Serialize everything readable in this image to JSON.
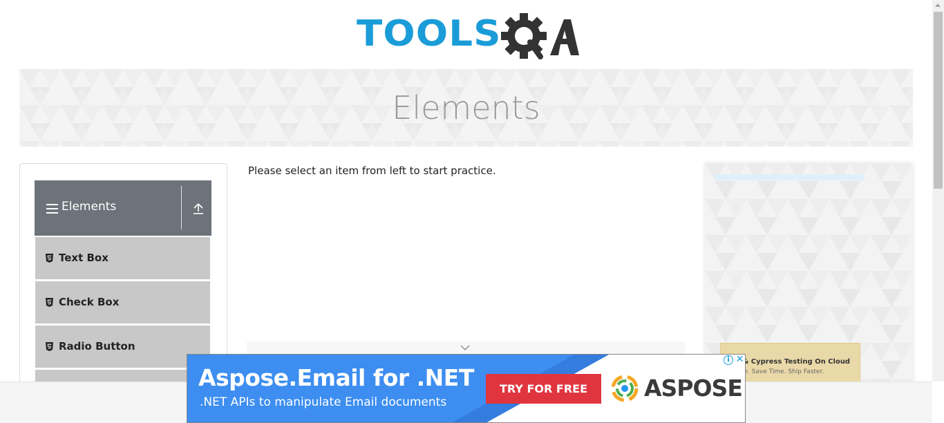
{
  "header": {
    "logo_text_tools": "TOOLS",
    "logo_text_qa": "QA",
    "brand_color": "#1a9cd8"
  },
  "banner": {
    "title": "Elements"
  },
  "sidebar": {
    "group": {
      "title": "Elements",
      "icon": "menu-icon",
      "collapse_icon": "upload-icon",
      "bg_color": "#6c737a"
    },
    "items": [
      {
        "label": "Text Box",
        "icon": "html5-icon"
      },
      {
        "label": "Check Box",
        "icon": "html5-icon"
      },
      {
        "label": "Radio Button",
        "icon": "html5-icon"
      }
    ]
  },
  "main": {
    "instruction": "Please select an item from left to start practice."
  },
  "right_ad": {
    "line1": "nium & Cypress Testing On Cloud",
    "line2": "est More. Save Time. Ship Faster."
  },
  "ad_banner": {
    "title": "Aspose.Email for .NET",
    "subtitle": ".NET APIs to manipulate Email documents",
    "cta": "TRY FOR FREE",
    "brand": "ASPOSE",
    "info_glyph": "i",
    "close_glyph": "✕",
    "bg_color": "#3d8ef0",
    "cta_color": "#e0353f"
  }
}
